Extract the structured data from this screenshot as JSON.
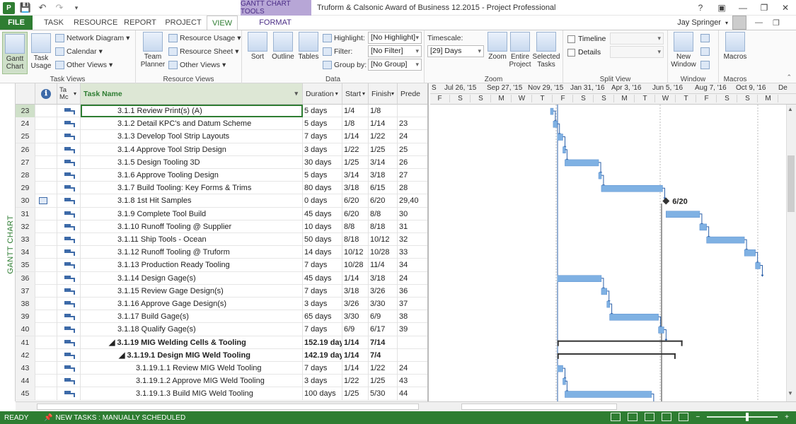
{
  "title_bar": {
    "window_title": "Truform & Calsonic Award of Business 12.2015 - Project Professional",
    "context_tools": "GANTT CHART TOOLS",
    "help": "?",
    "app_icon": "P"
  },
  "tabs": {
    "file": "FILE",
    "task": "TASK",
    "resource": "RESOURCE",
    "report": "REPORT",
    "project": "PROJECT",
    "view": "VIEW",
    "format": "FORMAT"
  },
  "user": {
    "name": "Jay Springer"
  },
  "ribbon": {
    "task_views": {
      "label": "Task Views",
      "gantt": "Gantt Chart",
      "task_usage": "Task Usage",
      "network": "Network Diagram",
      "calendar": "Calendar",
      "other": "Other Views"
    },
    "resource_views": {
      "label": "Resource Views",
      "team_planner": "Team Planner",
      "usage": "Resource Usage",
      "sheet": "Resource Sheet",
      "other": "Other Views"
    },
    "data": {
      "label": "Data",
      "sort": "Sort",
      "outline": "Outline",
      "tables": "Tables",
      "highlight": "Highlight:",
      "highlight_val": "[No Highlight]",
      "filter": "Filter:",
      "filter_val": "[No Filter]",
      "group": "Group by:",
      "group_val": "[No Group]"
    },
    "zoom": {
      "label": "Zoom",
      "timescale": "Timescale:",
      "timescale_val": "[29] Days",
      "zoom": "Zoom",
      "entire": "Entire Project",
      "selected": "Selected Tasks"
    },
    "split": {
      "label": "Split View",
      "timeline": "Timeline",
      "details": "Details"
    },
    "window": {
      "label": "Window",
      "new_window": "New Window"
    },
    "macros": {
      "label": "Macros",
      "macros": "Macros"
    }
  },
  "side_label": "GANTT CHART",
  "columns": {
    "info": "ℹ",
    "mode": "Task Mode",
    "name": "Task Name",
    "duration": "Duration",
    "start": "Start",
    "finish": "Finish",
    "pred": "Predecessors"
  },
  "column_headers_display": {
    "mode": "Ta Mc",
    "start": "Start",
    "finish": "Finish",
    "pred": "Prede"
  },
  "rows": [
    {
      "id": "23",
      "name": "3.1.1 Review Print(s) (A)",
      "dur": "5 days",
      "start": "1/4",
      "finish": "1/8",
      "pred": "",
      "lvl": 3,
      "bold": false,
      "ind": false
    },
    {
      "id": "24",
      "name": "3.1.2 Detail KPC's and Datum Scheme",
      "dur": "5 days",
      "start": "1/8",
      "finish": "1/14",
      "pred": "23",
      "lvl": 3,
      "bold": false,
      "ind": false
    },
    {
      "id": "25",
      "name": "3.1.3 Develop Tool Strip Layouts",
      "dur": "7 days",
      "start": "1/14",
      "finish": "1/22",
      "pred": "24",
      "lvl": 3,
      "bold": false,
      "ind": false
    },
    {
      "id": "26",
      "name": "3.1.4 Approve Tool Strip Design",
      "dur": "3 days",
      "start": "1/22",
      "finish": "1/25",
      "pred": "25",
      "lvl": 3,
      "bold": false,
      "ind": false
    },
    {
      "id": "27",
      "name": "3.1.5 Design Tooling 3D",
      "dur": "30 days",
      "start": "1/25",
      "finish": "3/14",
      "pred": "26",
      "lvl": 3,
      "bold": false,
      "ind": false
    },
    {
      "id": "28",
      "name": "3.1.6 Approve Tooling Design",
      "dur": "5 days",
      "start": "3/14",
      "finish": "3/18",
      "pred": "27",
      "lvl": 3,
      "bold": false,
      "ind": false
    },
    {
      "id": "29",
      "name": "3.1.7 Build Tooling: Key Forms & Trims",
      "dur": "80 days",
      "start": "3/18",
      "finish": "6/15",
      "pred": "28",
      "lvl": 3,
      "bold": false,
      "ind": false
    },
    {
      "id": "30",
      "name": "3.1.8 1st Hit Samples",
      "dur": "0 days",
      "start": "6/20",
      "finish": "6/20",
      "pred": "29,40",
      "lvl": 3,
      "bold": false,
      "ind": true
    },
    {
      "id": "31",
      "name": "3.1.9 Complete Tool Build",
      "dur": "45 days",
      "start": "6/20",
      "finish": "8/8",
      "pred": "30",
      "lvl": 3,
      "bold": false,
      "ind": false
    },
    {
      "id": "32",
      "name": "3.1.10 Runoff Tooling @ Supplier",
      "dur": "10 days",
      "start": "8/8",
      "finish": "8/18",
      "pred": "31",
      "lvl": 3,
      "bold": false,
      "ind": false
    },
    {
      "id": "33",
      "name": "3.1.11 Ship Tools  - Ocean",
      "dur": "50 days",
      "start": "8/18",
      "finish": "10/12",
      "pred": "32",
      "lvl": 3,
      "bold": false,
      "ind": false
    },
    {
      "id": "34",
      "name": "3.1.12 Runoff Tooling @ Truform",
      "dur": "14 days",
      "start": "10/12",
      "finish": "10/28",
      "pred": "33",
      "lvl": 3,
      "bold": false,
      "ind": false
    },
    {
      "id": "35",
      "name": "3.1.13 Production Ready Tooling",
      "dur": "7 days",
      "start": "10/28",
      "finish": "11/4",
      "pred": "34",
      "lvl": 3,
      "bold": false,
      "ind": false
    },
    {
      "id": "36",
      "name": "3.1.14 Design Gage(s)",
      "dur": "45 days",
      "start": "1/14",
      "finish": "3/18",
      "pred": "24",
      "lvl": 3,
      "bold": false,
      "ind": false
    },
    {
      "id": "37",
      "name": "3.1.15 Review Gage Design(s)",
      "dur": "7 days",
      "start": "3/18",
      "finish": "3/26",
      "pred": "36",
      "lvl": 3,
      "bold": false,
      "ind": false
    },
    {
      "id": "38",
      "name": "3.1.16 Approve Gage Design(s)",
      "dur": "3 days",
      "start": "3/26",
      "finish": "3/30",
      "pred": "37",
      "lvl": 3,
      "bold": false,
      "ind": false
    },
    {
      "id": "39",
      "name": "3.1.17 Build Gage(s)",
      "dur": "65 days",
      "start": "3/30",
      "finish": "6/9",
      "pred": "38",
      "lvl": 3,
      "bold": false,
      "ind": false
    },
    {
      "id": "40",
      "name": "3.1.18 Qualify Gage(s)",
      "dur": "7 days",
      "start": "6/9",
      "finish": "6/17",
      "pred": "39",
      "lvl": 3,
      "bold": false,
      "ind": false
    },
    {
      "id": "41",
      "name": "◢ 3.1.19 MIG Welding Cells & Tooling",
      "dur": "152.19 days",
      "start": "1/14",
      "finish": "7/14",
      "pred": "",
      "lvl": 2,
      "bold": true,
      "ind": false
    },
    {
      "id": "42",
      "name": "◢ 3.1.19.1 Design MIG Weld Tooling",
      "dur": "142.19 days",
      "start": "1/14",
      "finish": "7/4",
      "pred": "",
      "lvl": 2.5,
      "bold": true,
      "ind": false
    },
    {
      "id": "43",
      "name": "3.1.19.1.1 Review MIG Weld Tooling",
      "dur": "7 days",
      "start": "1/14",
      "finish": "1/22",
      "pred": "24",
      "lvl": 4,
      "bold": false,
      "ind": false
    },
    {
      "id": "44",
      "name": "3.1.19.1.2 Approve MIG Weld Tooling",
      "dur": "3 days",
      "start": "1/22",
      "finish": "1/25",
      "pred": "43",
      "lvl": 4,
      "bold": false,
      "ind": false
    },
    {
      "id": "45",
      "name": "3.1.19.1.3 Build MIG Weld Tooling",
      "dur": "100 days",
      "start": "1/25",
      "finish": "5/30",
      "pred": "44",
      "lvl": 4,
      "bold": false,
      "ind": false
    }
  ],
  "timescale": {
    "top": [
      "S",
      "Jul 26, '15",
      "Sep 27, '15",
      "Nov 29, '15",
      "Jan 31, '16",
      "Apr 3, '16",
      "Jun 5, '16",
      "Aug 7, '16",
      "Oct 9, '16",
      "De"
    ],
    "bottom": [
      "F",
      "S",
      "S",
      "M",
      "W",
      "T",
      "F",
      "S",
      "S",
      "M",
      "T",
      "W",
      "T",
      "F",
      "S",
      "S",
      "M"
    ]
  },
  "milestone_label": "6/20",
  "status": {
    "ready": "READY",
    "new_tasks": "NEW TASKS : MANUALLY SCHEDULED"
  },
  "colors": {
    "accent": "#2e7d32",
    "bar": "#7fb1e3",
    "summary": "#333333"
  }
}
